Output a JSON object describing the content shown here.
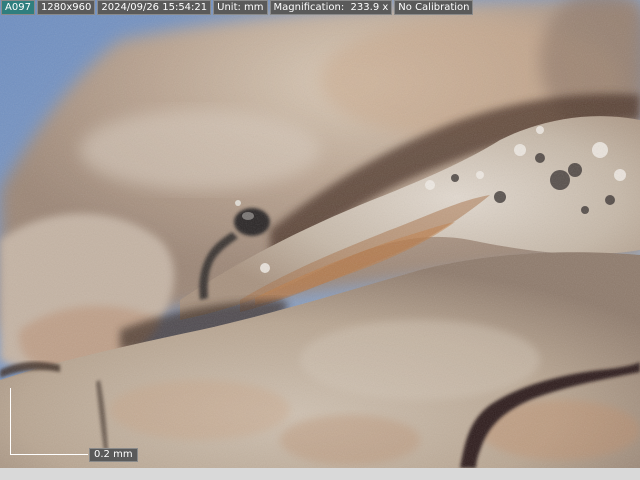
{
  "overlay": {
    "image_id": "A097",
    "resolution": "1280x960",
    "datetime": "2024/09/26 15:54:21",
    "unit": "Unit: mm",
    "magnification": "Magnification:  233.9 x",
    "calibration": "No Calibration"
  },
  "scale_bar": {
    "label": "0.2 mm"
  },
  "colors": {
    "sky": "#6f8fbf",
    "rock_light": "#cdbfae",
    "rock_mid": "#a89684",
    "crack": "#3a2a22",
    "rust": "#b5682e",
    "label_bg": "#5a5a5a",
    "id_bg": "#2f7e7e"
  }
}
